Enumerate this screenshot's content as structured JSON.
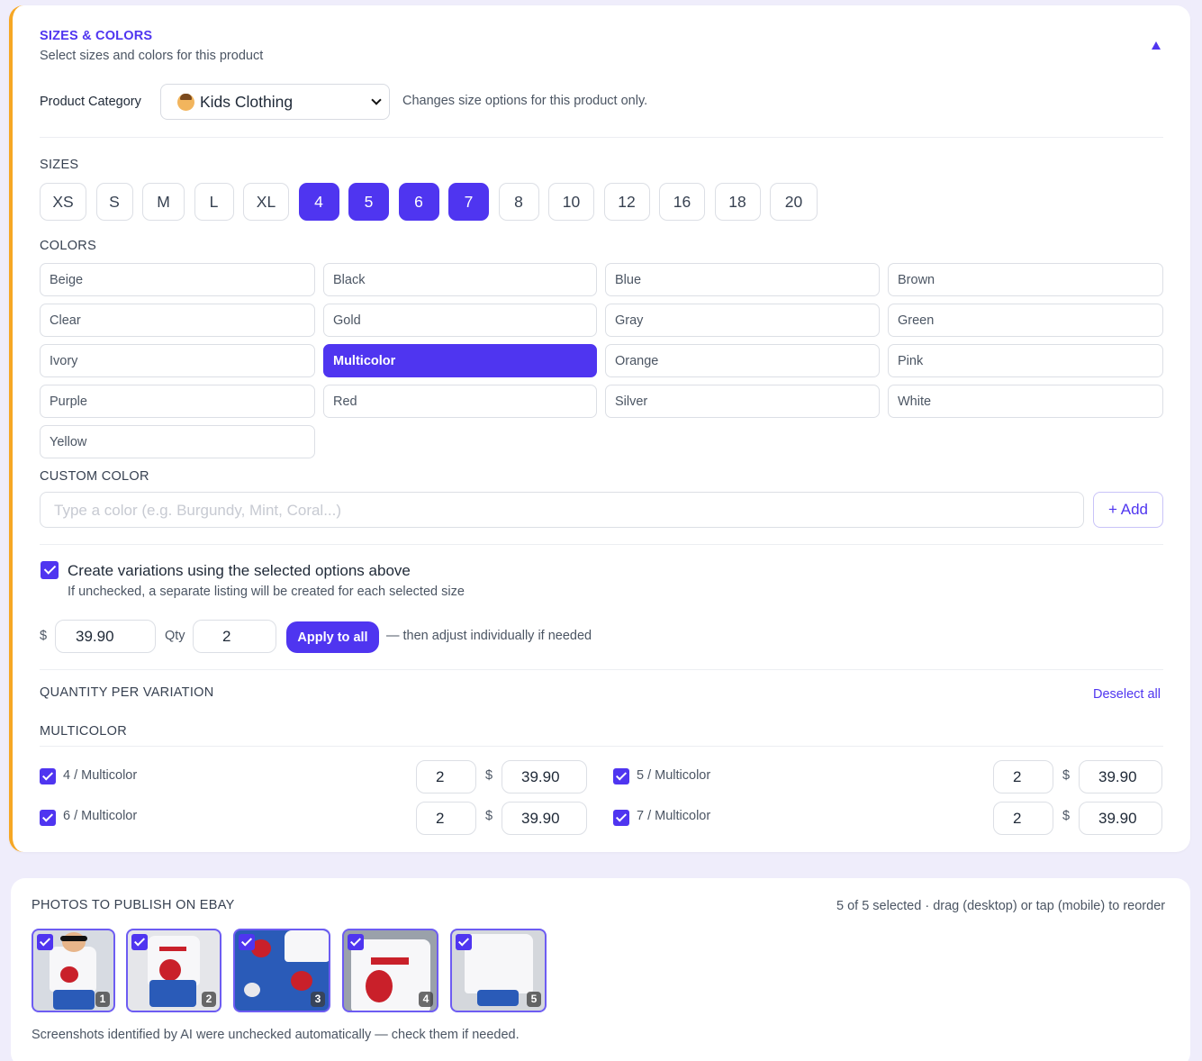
{
  "section": {
    "title": "SIZES & COLORS",
    "subtitle": "Select sizes and colors for this product"
  },
  "category": {
    "label": "Product Category",
    "selected": "Kids Clothing",
    "note": "Changes size options for this product only."
  },
  "sizes": {
    "heading": "SIZES",
    "items": [
      {
        "label": "XS",
        "selected": false
      },
      {
        "label": "S",
        "selected": false
      },
      {
        "label": "M",
        "selected": false
      },
      {
        "label": "L",
        "selected": false
      },
      {
        "label": "XL",
        "selected": false
      },
      {
        "label": "4",
        "selected": true
      },
      {
        "label": "5",
        "selected": true
      },
      {
        "label": "6",
        "selected": true
      },
      {
        "label": "7",
        "selected": true
      },
      {
        "label": "8",
        "selected": false
      },
      {
        "label": "10",
        "selected": false
      },
      {
        "label": "12",
        "selected": false
      },
      {
        "label": "16",
        "selected": false
      },
      {
        "label": "18",
        "selected": false
      },
      {
        "label": "20",
        "selected": false
      }
    ]
  },
  "colors": {
    "heading": "COLORS",
    "items": [
      {
        "label": "Beige",
        "selected": false
      },
      {
        "label": "Black",
        "selected": false
      },
      {
        "label": "Blue",
        "selected": false
      },
      {
        "label": "Brown",
        "selected": false
      },
      {
        "label": "Clear",
        "selected": false
      },
      {
        "label": "Gold",
        "selected": false
      },
      {
        "label": "Gray",
        "selected": false
      },
      {
        "label": "Green",
        "selected": false
      },
      {
        "label": "Ivory",
        "selected": false
      },
      {
        "label": "Multicolor",
        "selected": true
      },
      {
        "label": "Orange",
        "selected": false
      },
      {
        "label": "Pink",
        "selected": false
      },
      {
        "label": "Purple",
        "selected": false
      },
      {
        "label": "Red",
        "selected": false
      },
      {
        "label": "Silver",
        "selected": false
      },
      {
        "label": "White",
        "selected": false
      },
      {
        "label": "Yellow",
        "selected": false
      }
    ]
  },
  "custom_color": {
    "heading": "CUSTOM COLOR",
    "placeholder": "Type a color (e.g. Burgundy, Mint, Coral...)",
    "add_label": "+ Add"
  },
  "variations": {
    "checkbox_label": "Create variations using the selected options above",
    "checked": true,
    "hint": "If unchecked, a separate listing will be created for each selected size",
    "currency": "$",
    "price": "39.90",
    "qty_label": "Qty",
    "qty": "2",
    "apply_label": "Apply to all",
    "apply_note": "— then adjust individually if needed"
  },
  "quantity": {
    "heading": "QUANTITY PER VARIATION",
    "deselect_label": "Deselect all",
    "group": "MULTICOLOR",
    "currency": "$",
    "rows": [
      {
        "label": "4 / Multicolor",
        "qty": "2",
        "price": "39.90",
        "checked": true
      },
      {
        "label": "5 / Multicolor",
        "qty": "2",
        "price": "39.90",
        "checked": true
      },
      {
        "label": "6 / Multicolor",
        "qty": "2",
        "price": "39.90",
        "checked": true
      },
      {
        "label": "7 / Multicolor",
        "qty": "2",
        "price": "39.90",
        "checked": true
      }
    ]
  },
  "photos": {
    "heading": "PHOTOS TO PUBLISH ON EBAY",
    "status": "5 of 5 selected · drag (desktop) or tap (mobile) to reorder",
    "numbers": [
      "1",
      "2",
      "3",
      "4",
      "5"
    ],
    "footer": "Screenshots identified by AI were unchecked automatically — check them if needed."
  },
  "colors_theme": {
    "accent": "#4f35f0",
    "border_accent": "#f6a724",
    "background": "#efedfb"
  }
}
